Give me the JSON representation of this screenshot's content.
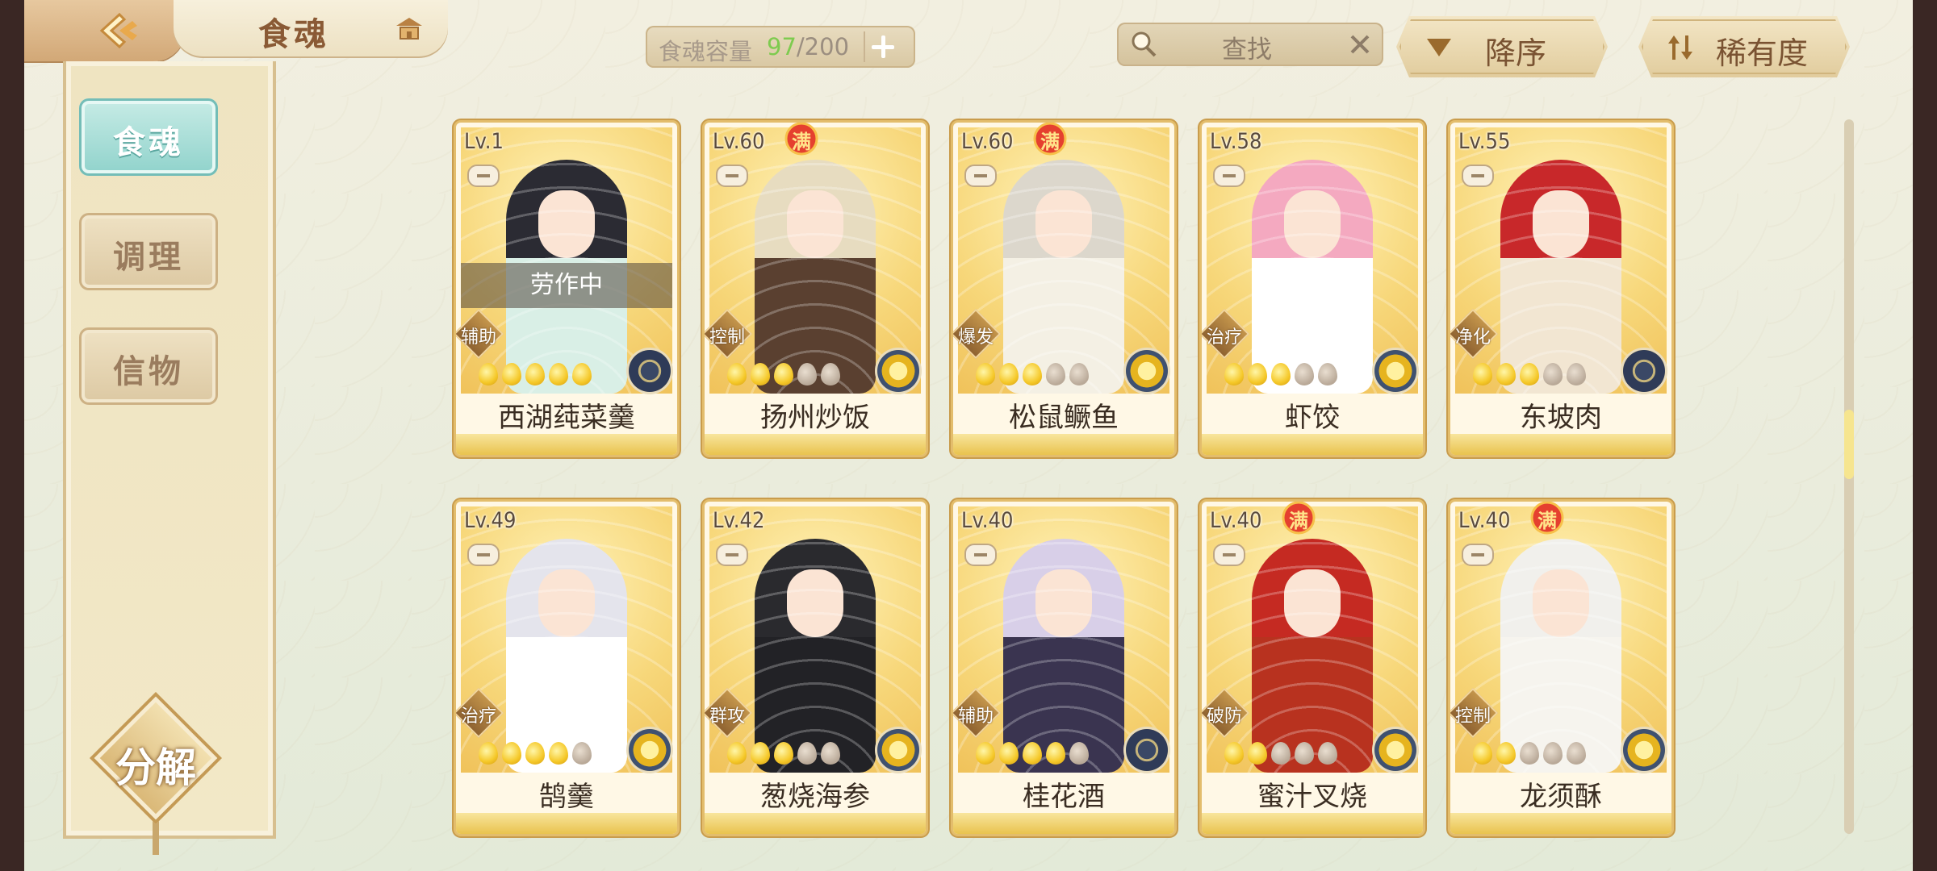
{
  "header": {
    "title": "食魂",
    "capacity": {
      "label": "食魂容量",
      "current": "97",
      "max": "/200"
    },
    "search": {
      "placeholder": "查找"
    },
    "sort_order_label": "降序",
    "sort_by_label": "稀有度"
  },
  "sidebar": {
    "items": [
      {
        "label": "食魂",
        "active": true
      },
      {
        "label": "调理",
        "active": false
      },
      {
        "label": "信物",
        "active": false
      }
    ],
    "decompose_label": "分解"
  },
  "colors": {
    "accent": "#f0c25a",
    "active_tab": "#8fd2cb",
    "capacity_current": "#7ecb4f"
  },
  "cards": [
    {
      "level": "Lv.1",
      "name": "西湖莼菜羹",
      "role": "辅助",
      "stars": 5,
      "stars_lit": 5,
      "full": false,
      "status": "劳作中",
      "element": "dark",
      "hair": "#2b2b33",
      "outfit": "#d9efe6"
    },
    {
      "level": "Lv.60",
      "name": "扬州炒饭",
      "role": "控制",
      "stars": 5,
      "stars_lit": 3,
      "full": true,
      "full_label": "满",
      "element": "gold",
      "hair": "#e7dcc0",
      "outfit": "#5a4030"
    },
    {
      "level": "Lv.60",
      "name": "松鼠鳜鱼",
      "role": "爆发",
      "stars": 5,
      "stars_lit": 3,
      "full": true,
      "full_label": "满",
      "element": "gold",
      "hair": "#dcd7cc",
      "outfit": "#f4f0e4"
    },
    {
      "level": "Lv.58",
      "name": "虾饺",
      "role": "治疗",
      "stars": 5,
      "stars_lit": 3,
      "full": false,
      "element": "gold",
      "hair": "#f4a9c0",
      "outfit": "#ffffff"
    },
    {
      "level": "Lv.55",
      "name": "东坡肉",
      "role": "净化",
      "stars": 5,
      "stars_lit": 3,
      "full": false,
      "element": "dark",
      "hair": "#c8282a",
      "outfit": "#f2e6d2"
    },
    {
      "level": "Lv.49",
      "name": "鹄羹",
      "role": "治疗",
      "stars": 5,
      "stars_lit": 4,
      "full": false,
      "element": "gold",
      "hair": "#e4e4ec",
      "outfit": "#ffffff"
    },
    {
      "level": "Lv.42",
      "name": "葱烧海参",
      "role": "群攻",
      "stars": 5,
      "stars_lit": 3,
      "full": false,
      "element": "gold",
      "hair": "#2a2a2e",
      "outfit": "#222226"
    },
    {
      "level": "Lv.40",
      "name": "桂花酒",
      "role": "辅助",
      "stars": 5,
      "stars_lit": 4,
      "full": false,
      "element": "dark",
      "hair": "#d8cfe8",
      "outfit": "#3a3450"
    },
    {
      "level": "Lv.40",
      "name": "蜜汁叉烧",
      "role": "破防",
      "stars": 5,
      "stars_lit": 2,
      "full": true,
      "full_label": "满",
      "element": "gold",
      "hair": "#c52a22",
      "outfit": "#b8321f"
    },
    {
      "level": "Lv.40",
      "name": "龙须酥",
      "role": "控制",
      "stars": 5,
      "stars_lit": 2,
      "full": true,
      "full_label": "满",
      "element": "gold",
      "hair": "#f1f0ec",
      "outfit": "#f6f4ee"
    }
  ]
}
